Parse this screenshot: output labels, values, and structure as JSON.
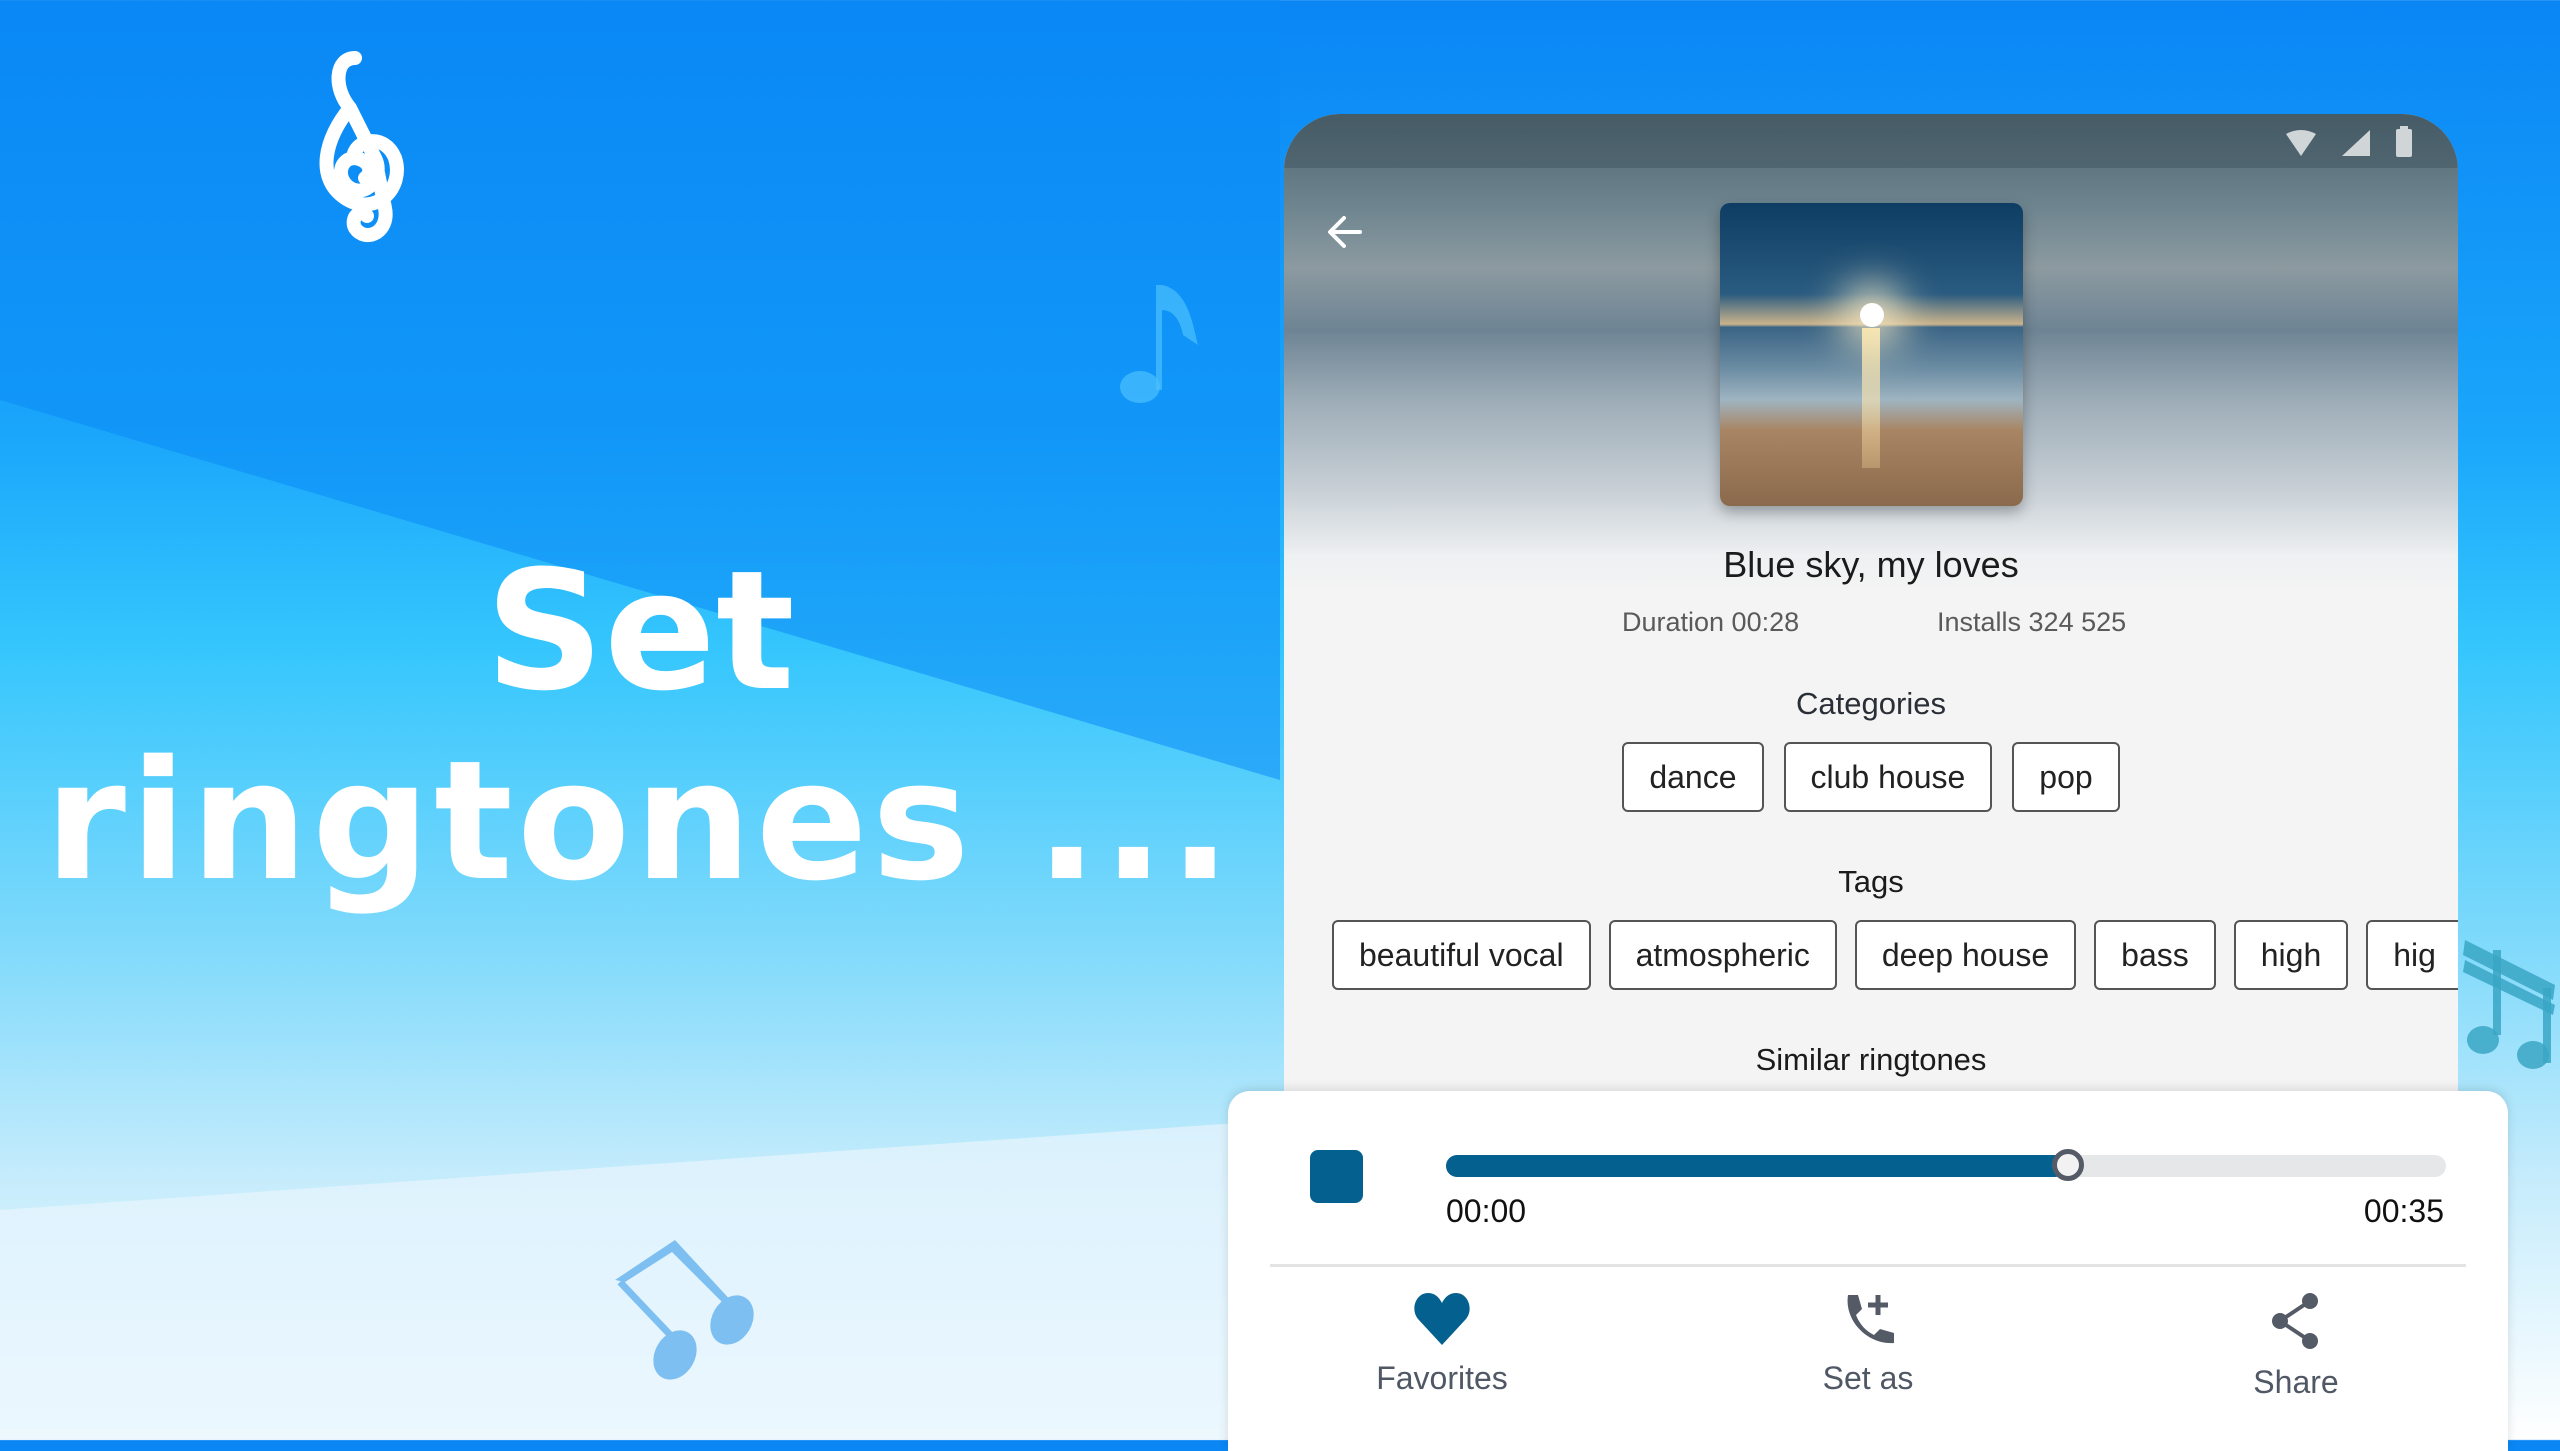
{
  "promo": {
    "headline_line1": "Set",
    "headline_line2": "ringtones ..."
  },
  "decor_icons": [
    "treble-clef-icon",
    "eighth-note-icon",
    "beamed-notes-icon",
    "beamed-sixteenth-notes-icon"
  ],
  "status_bar": {
    "icons": [
      "wifi-icon",
      "signal-icon",
      "battery-icon"
    ]
  },
  "header": {
    "back_icon": "arrow-left-icon"
  },
  "ringtone": {
    "title": "Blue sky, my loves",
    "duration_label": "Duration 00:28",
    "installs_label": "Installs 324 525"
  },
  "categories": {
    "heading": "Categories",
    "items": [
      "dance",
      "club house",
      "pop"
    ]
  },
  "tags": {
    "heading": "Tags",
    "items": [
      "beautiful vocal",
      "atmospheric",
      "deep house",
      "bass",
      "high",
      "hig"
    ]
  },
  "similar": {
    "heading": "Similar ringtones"
  },
  "player": {
    "state": "playing",
    "progress_percent": 62,
    "time_start": "00:00",
    "time_end": "00:35",
    "accent_color": "#04618f"
  },
  "actions": [
    {
      "label": "Favorites",
      "icon": "heart-icon"
    },
    {
      "label": "Set as",
      "icon": "phone-add-icon"
    },
    {
      "label": "Share",
      "icon": "share-icon"
    }
  ]
}
